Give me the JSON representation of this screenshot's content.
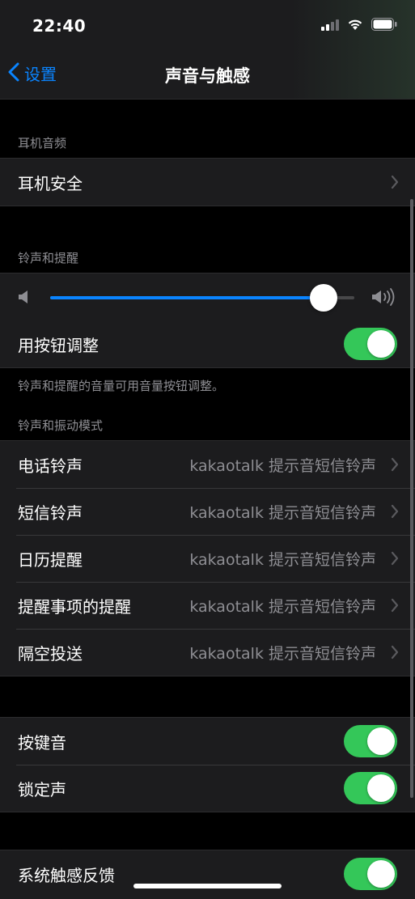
{
  "status_bar": {
    "time": "22:40"
  },
  "nav": {
    "back_label": "设置",
    "title": "声音与触感"
  },
  "headphone_section": {
    "header": "耳机音频",
    "items": [
      {
        "label": "耳机安全"
      }
    ]
  },
  "ringer_section": {
    "header": "铃声和提醒",
    "volume_level": 0.9,
    "adjust_with_buttons": {
      "label": "用按钮调整",
      "on": true
    },
    "footer": "铃声和提醒的音量可用音量按钮调整。"
  },
  "sounds_section": {
    "header": "铃声和振动模式",
    "items": [
      {
        "label": "电话铃声",
        "value": "kakaotalk 提示音短信铃声"
      },
      {
        "label": "短信铃声",
        "value": "kakaotalk 提示音短信铃声"
      },
      {
        "label": "日历提醒",
        "value": "kakaotalk 提示音短信铃声"
      },
      {
        "label": "提醒事项的提醒",
        "value": "kakaotalk 提示音短信铃声"
      },
      {
        "label": "隔空投送",
        "value": "kakaotalk 提示音短信铃声"
      }
    ]
  },
  "keyboard_section": {
    "items": [
      {
        "label": "按键音",
        "on": true
      },
      {
        "label": "锁定声",
        "on": true
      }
    ]
  },
  "haptics_section": {
    "items": [
      {
        "label": "系统触感反馈",
        "on": true
      }
    ]
  },
  "colors": {
    "accent": "#0a84ff",
    "toggle_on": "#34c759",
    "background": "#000000",
    "cell": "#1c1c1e"
  },
  "icons": [
    "cellular-signal-icon",
    "wifi-icon",
    "battery-icon",
    "back-chevron-icon",
    "chevron-right-icon",
    "speaker-low-icon",
    "speaker-high-icon"
  ]
}
